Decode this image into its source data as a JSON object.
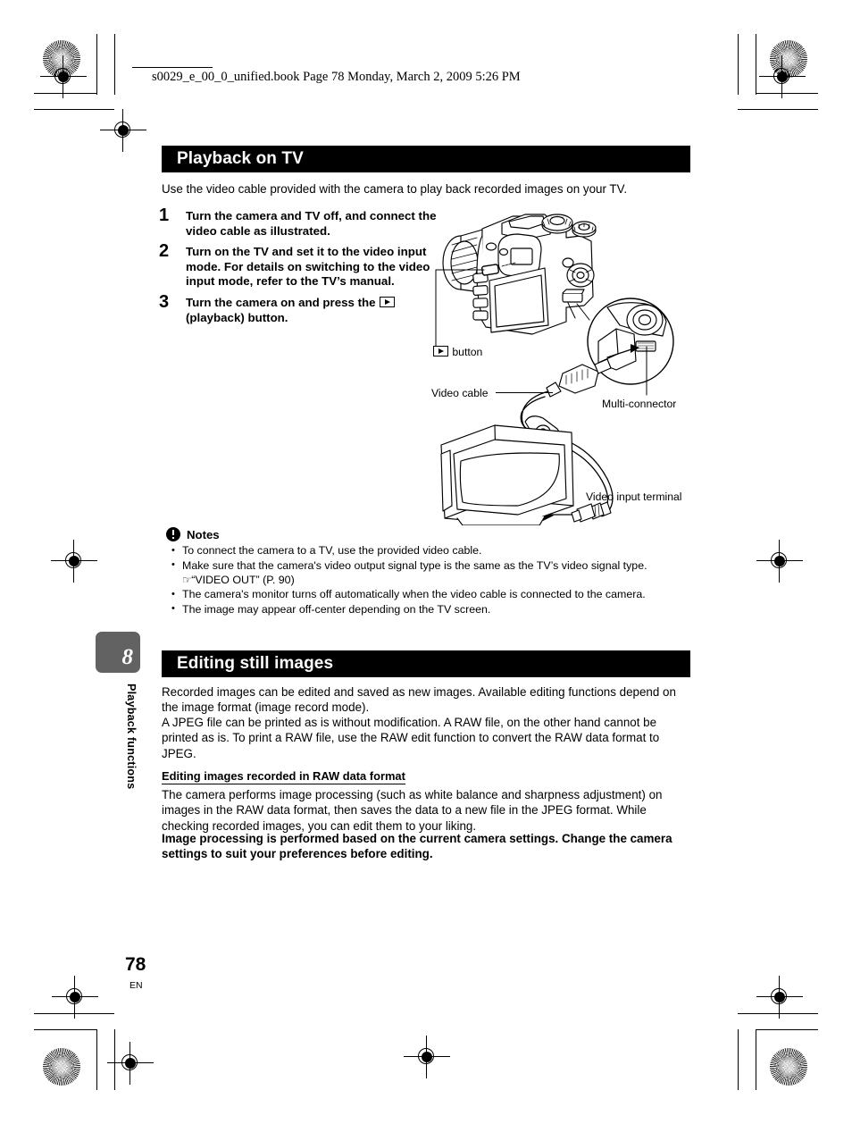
{
  "print_header": {
    "file_line": "s0029_e_00_0_unified.book  Page 78  Monday, March 2, 2009  5:26 PM"
  },
  "section_playback": {
    "title": "Playback on TV",
    "intro": "Use the video cable provided with the camera to play back recorded images on your TV.",
    "steps": [
      {
        "num": "1",
        "text": "Turn the camera and TV off, and connect the video cable as illustrated."
      },
      {
        "num": "2",
        "text": "Turn on the TV and set it to the video input mode. For details on switching to the video input mode, refer to the TV’s manual."
      },
      {
        "num": "3a",
        "text": "Turn the camera on and press the "
      },
      {
        "num": "3b",
        "text": " (playback) button."
      }
    ],
    "step3_num": "3"
  },
  "illustration": {
    "label_play_button": "button",
    "label_video_cable": "Video cable",
    "label_multi_connector": "Multi-connector",
    "label_video_input_terminal": "Video input terminal"
  },
  "notes": {
    "title": "Notes",
    "items": [
      "To connect the camera to a TV, use the provided video cable.",
      "Make sure that the camera's video output signal type is the same as the TV’s video signal type.",
      "The camera's monitor turns off automatically when the video cable is connected to the camera.",
      "The image may appear off-center depending on the TV screen."
    ],
    "reference_hand": "☞",
    "reference_text": "“VIDEO OUT” (P. 90)"
  },
  "section_editing": {
    "title": "Editing still images",
    "paragraph1": "Recorded images can be edited and saved as new images. Available editing functions depend on the image format (image record mode).",
    "paragraph2": "A JPEG file can be printed as is without modification. A RAW file, on the other hand cannot be printed as is. To print a RAW file, use the RAW edit function to convert the RAW data format to JPEG.",
    "sub_heading": "Editing images recorded in RAW data format",
    "paragraph3": "The camera performs image processing (such as white balance and sharpness adjustment) on images in the RAW data format, then saves the data to a new file in the JPEG format. While checking recorded images, you can edit them to your liking.",
    "paragraph4_bold": "Image processing is performed based on the current camera settings. Change the camera settings to suit your preferences before editing."
  },
  "chapter": {
    "number": "8",
    "label": "Playback functions"
  },
  "footer": {
    "page_number": "78",
    "language": "EN"
  },
  "colors": {
    "bar_background": "#000000",
    "bar_text": "#ffffff",
    "chapter_tab": "#626262"
  }
}
